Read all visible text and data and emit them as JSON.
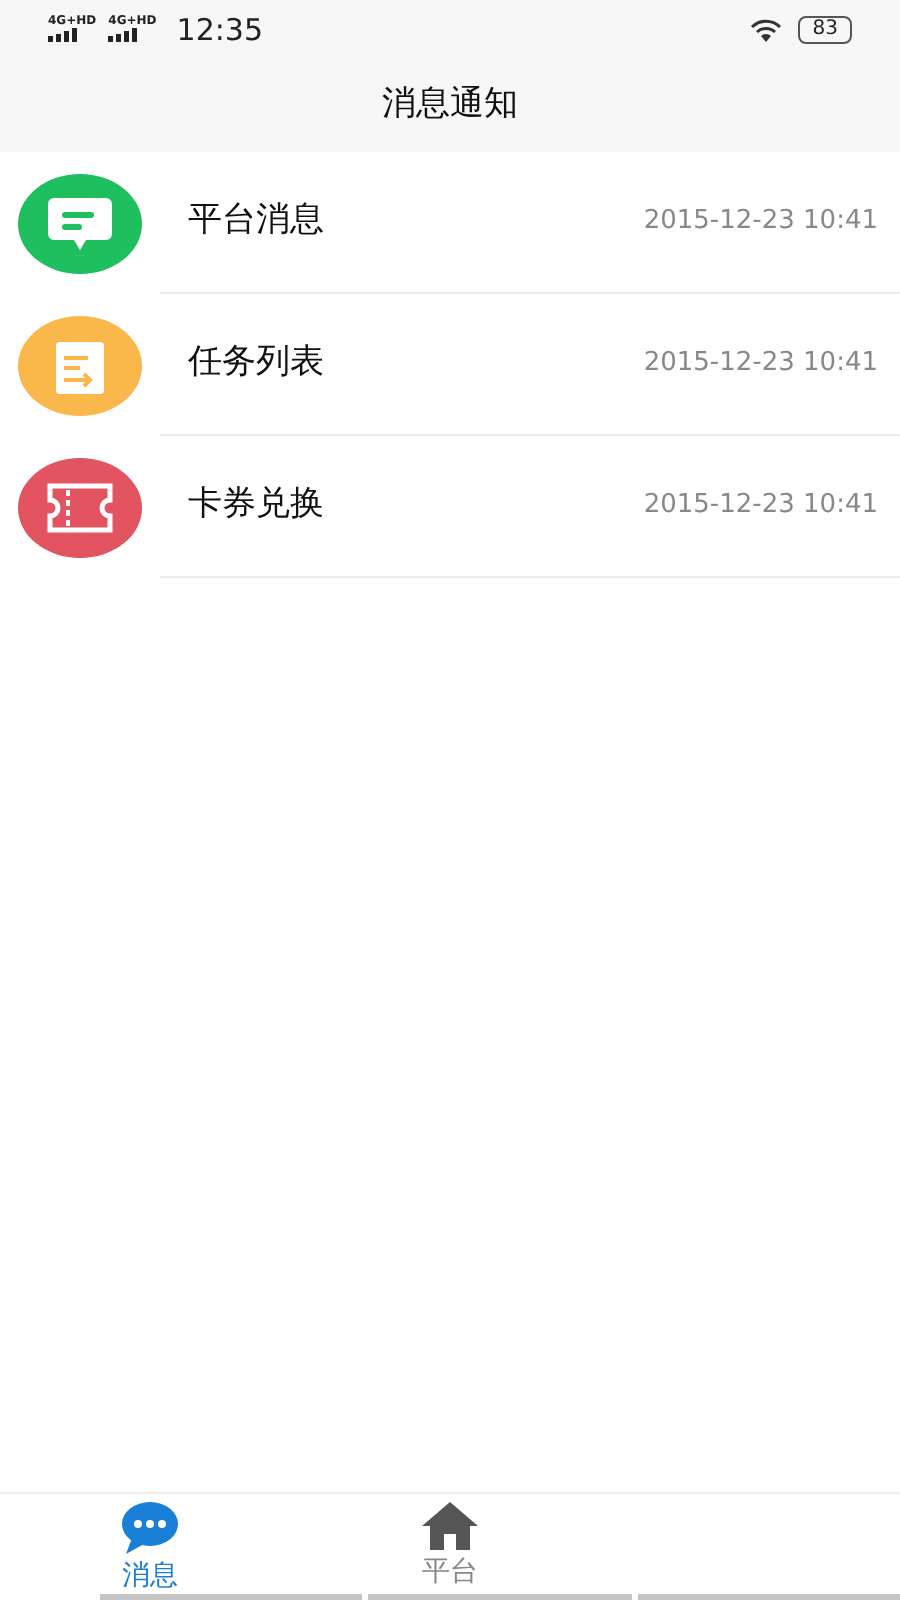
{
  "status_bar": {
    "network_1": "4G+HD",
    "network_2": "4G+HD",
    "time": "12:35",
    "battery": "83"
  },
  "header": {
    "title": "消息通知"
  },
  "items": [
    {
      "title": "平台消息",
      "time": "2015-12-23 10:41",
      "kind": "message",
      "color": "#1fbf5f"
    },
    {
      "title": "任务列表",
      "time": "2015-12-23 10:41",
      "kind": "task",
      "color": "#fbb84a"
    },
    {
      "title": "卡券兑换",
      "time": "2015-12-23 10:41",
      "kind": "coupon",
      "color": "#e2545f"
    }
  ],
  "tabs": [
    {
      "label": "消息",
      "selected": true,
      "kind": "chat"
    },
    {
      "label": "平台",
      "selected": false,
      "kind": "home"
    }
  ]
}
